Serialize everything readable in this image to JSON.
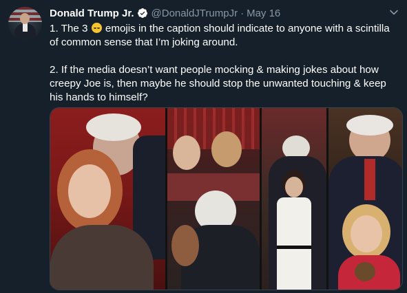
{
  "tweet": {
    "author_name": "Donald Trump Jr.",
    "handle": "@DonaldJTrumpJr",
    "separator": "·",
    "date": "May 16",
    "paragraph1_a": "1. The 3 ",
    "paragraph1_b": " emojis in the caption should indicate to anyone with a scintilla of common sense that I’m joking around.",
    "paragraph2": "2. If the media doesn’t want people mocking & making jokes about how creepy Joe is, then maybe he should stop the unwanted touching & keep his hands to himself?"
  },
  "icons": {
    "verified": "verified-badge-icon",
    "menu": "chevron-down-icon",
    "emoji": "rolling-on-the-floor-laughing-emoji"
  },
  "colors": {
    "background": "#15202b",
    "text": "#ffffff",
    "secondary_text": "#8899a6",
    "verified_blue": "#1da1f2",
    "border": "#38444d"
  }
}
